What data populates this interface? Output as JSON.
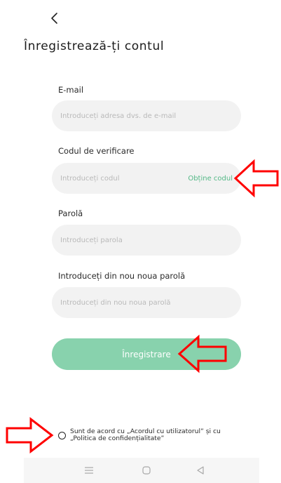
{
  "header": {
    "back_icon": "chevron-left-icon",
    "title": "Înregistrează-ți contul"
  },
  "form": {
    "email": {
      "label": "E-mail",
      "placeholder": "Introduceți adresa dvs. de e-mail",
      "value": ""
    },
    "code": {
      "label": "Codul de verificare",
      "placeholder": "Introduceți codul",
      "value": "",
      "action_label": "Obține codul"
    },
    "password": {
      "label": "Parolă",
      "placeholder": "Introduceți parola",
      "value": ""
    },
    "password_confirm": {
      "label": "Introduceți din nou noua parolă",
      "placeholder": "Introduceți din nou noua parolă",
      "value": ""
    },
    "submit_label": "Înregistrare"
  },
  "consent": {
    "checked": false,
    "line1": "Sunt de acord cu „Acordul cu utilizatorul” și cu",
    "line2": "„Politica de confidențialitate”"
  },
  "nav_bar": {
    "items": [
      "menu-icon",
      "home-icon",
      "back-triangle-icon"
    ]
  },
  "annotations": {
    "arrow_color": "#ff0000",
    "arrow_icon": "red-outline-arrow-icon"
  },
  "colors": {
    "accent": "#54b886",
    "button_bg": "#88d2ad",
    "input_bg": "#f2f2f2"
  }
}
